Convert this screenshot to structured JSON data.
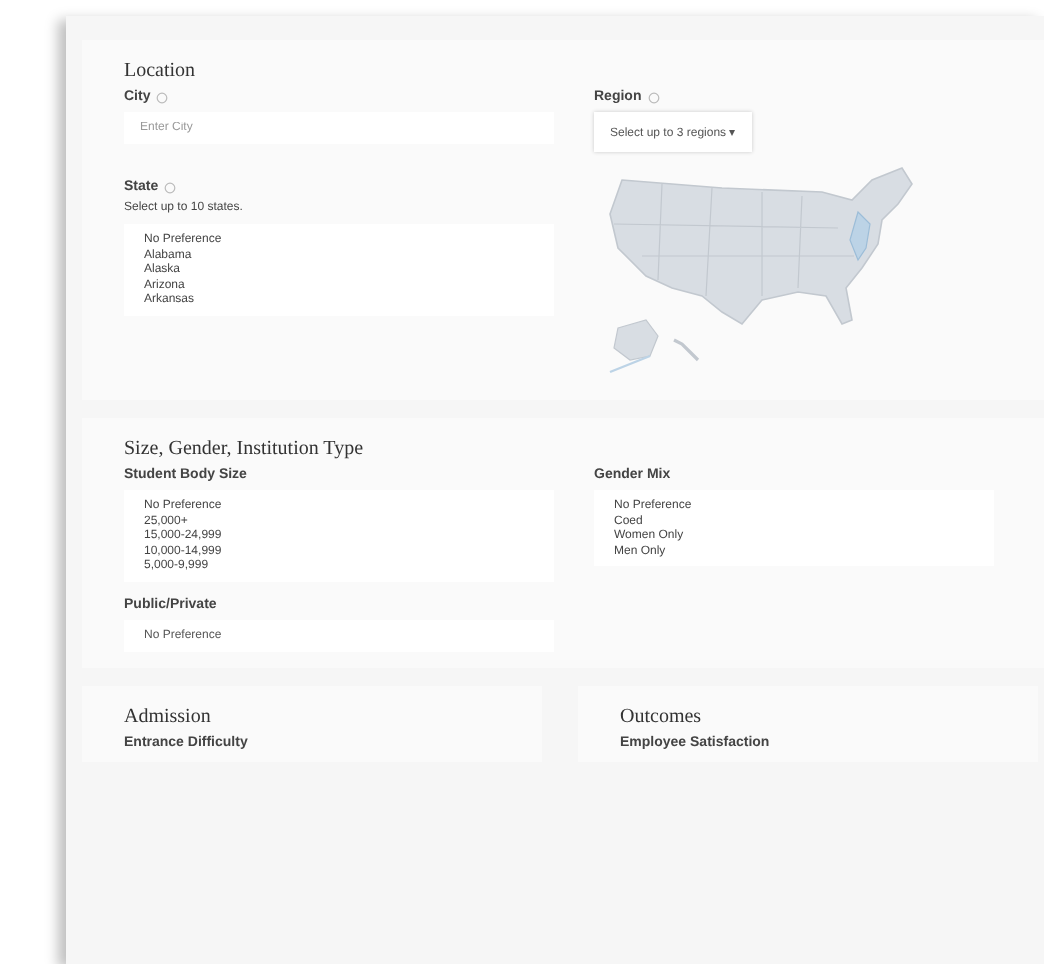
{
  "location": {
    "title": "Location",
    "city": {
      "label": "City",
      "placeholder": "Enter City"
    },
    "region": {
      "label": "Region",
      "value": "Select up to 3 regions",
      "caret": "▾"
    },
    "state": {
      "label": "State",
      "hint": "Select up to 10 states.",
      "options": [
        "No Preference",
        "Alabama",
        "Alaska",
        "Arizona",
        "Arkansas"
      ]
    }
  },
  "size_gender_type": {
    "title": "Size, Gender, Institution Type",
    "student_body_size": {
      "label": "Student Body Size",
      "options": [
        "No Preference",
        "25,000+",
        "15,000-24,999",
        "10,000-14,999",
        "5,000-9,999"
      ]
    },
    "gender_mix": {
      "label": "Gender Mix",
      "options": [
        "No Preference",
        "Coed",
        "Women Only",
        "Men Only"
      ]
    },
    "public_private": {
      "label": "Public/Private",
      "value": "No Preference"
    }
  },
  "admission": {
    "title": "Admission",
    "label": "Entrance Difficulty"
  },
  "outcomes": {
    "title": "Outcomes",
    "label": "Employee Satisfaction"
  }
}
